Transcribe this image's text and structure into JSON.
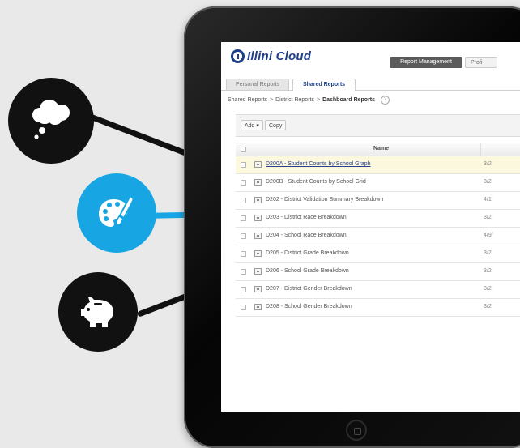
{
  "app": {
    "logo_text": "Illini Cloud"
  },
  "header": {
    "buttons": [
      {
        "label": "Report Management"
      },
      {
        "label": "Profi"
      }
    ]
  },
  "tabs": [
    {
      "label": "Personal Reports",
      "active": false
    },
    {
      "label": "Shared Reports",
      "active": true
    }
  ],
  "breadcrumb": {
    "items": [
      "Shared Reports",
      "District Reports",
      "Dashboard Reports"
    ],
    "separator": ">",
    "help": "?"
  },
  "toolbar": {
    "add_label": "Add",
    "add_caret": "▾",
    "copy_label": "Copy"
  },
  "table": {
    "header_name": "Name",
    "rows": [
      {
        "name": "D200A - Student Counts by School Graph",
        "date": "3/2!",
        "selected": true
      },
      {
        "name": "D200B - Student Counts by School Grid",
        "date": "3/2!",
        "selected": false
      },
      {
        "name": "D202 - District Validation Summary Breakdown",
        "date": "4/1!",
        "selected": false
      },
      {
        "name": "D203 - District Race Breakdown",
        "date": "3/2!",
        "selected": false
      },
      {
        "name": "D204 - School Race Breakdown",
        "date": "4/9/",
        "selected": false
      },
      {
        "name": "D205 - District Grade Breakdown",
        "date": "3/2!",
        "selected": false
      },
      {
        "name": "D206 - School Grade Breakdown",
        "date": "3/2!",
        "selected": false
      },
      {
        "name": "D207 - District Gender Breakdown",
        "date": "3/2!",
        "selected": false
      },
      {
        "name": "D208 - School Gender Breakdown",
        "date": "3/2!",
        "selected": false
      }
    ]
  },
  "callouts": [
    {
      "icon": "thought-cloud-icon",
      "color": "#111111"
    },
    {
      "icon": "palette-brush-icon",
      "color": "#17a6e3"
    },
    {
      "icon": "piggy-bank-icon",
      "color": "#111111"
    }
  ],
  "colors": {
    "brand": "#1e3f8a",
    "accent": "#17a6e3",
    "selected_row": "#fbf8dd"
  }
}
